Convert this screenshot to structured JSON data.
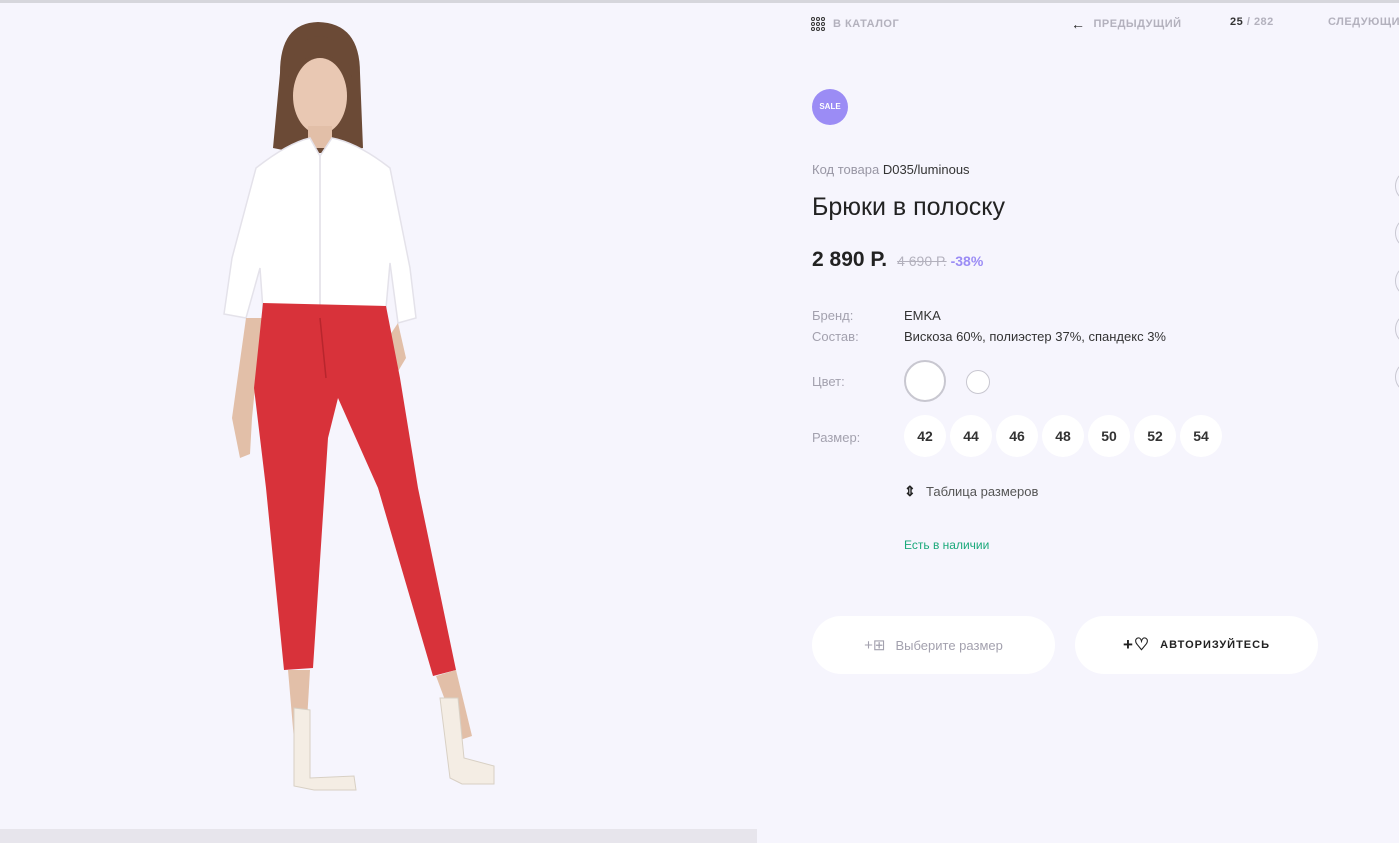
{
  "nav": {
    "catalog": "В КАТАЛОГ",
    "prev": "ПРЕДЫДУЩИЙ",
    "counter_current": "25",
    "counter_sep": "/",
    "counter_total": "282",
    "next": "СЛЕДУЮЩИЙ"
  },
  "badge": "SALE",
  "product": {
    "sku_label": "Код товара",
    "sku": "D035/luminous",
    "title": "Брюки в полоску",
    "price": "2 890 Р.",
    "old_price": "4 690 Р.",
    "discount": "-38%"
  },
  "props": {
    "brand_label": "Бренд:",
    "brand": "EMKA",
    "composition_label": "Состав:",
    "composition": "Вискоза 60%, полиэстер 37%, спандекс 3%",
    "color_label": "Цвет:",
    "size_label": "Размер:"
  },
  "sizes": [
    "42",
    "44",
    "46",
    "48",
    "50",
    "52",
    "54"
  ],
  "size_table": "Таблица размеров",
  "stock": "Есть в наличии",
  "buttons": {
    "select_size": "Выберите размер",
    "auth": "АВТОРИЗУЙТЕСЬ"
  },
  "icons": {
    "catalog": "grid-dots-icon",
    "prev": "arrow-left-icon",
    "size_table": "ruler-icon",
    "cart": "cart-plus-icon",
    "favorite": "heart-plus-icon"
  },
  "colors": {
    "accent": "#9b8cf5",
    "stock": "#1aa97a",
    "background": "#f6f5fd"
  }
}
